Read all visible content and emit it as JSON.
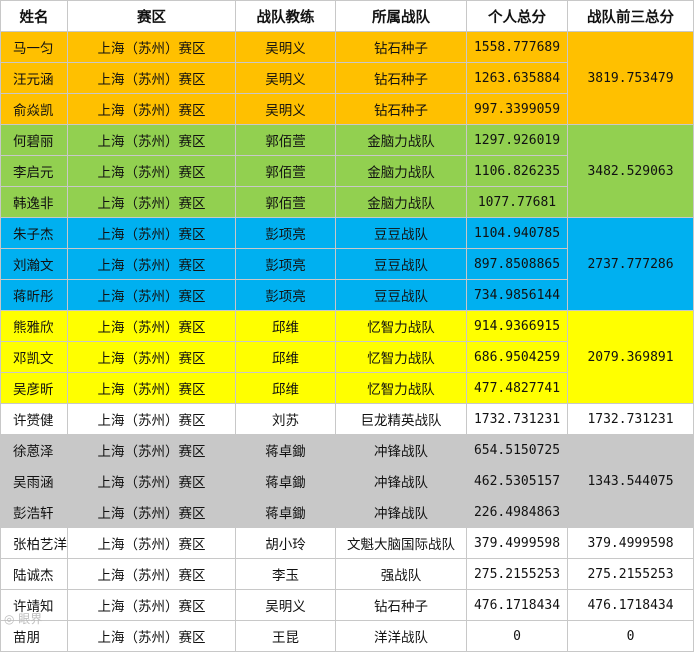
{
  "headers": [
    "姓名",
    "赛区",
    "战队教练",
    "所属战队",
    "个人总分",
    "战队前三总分"
  ],
  "groups": [
    {
      "color": "#ffc000",
      "total": "3819.753479",
      "rows": [
        [
          "马一匀",
          "上海（苏州）赛区",
          "吴明义",
          "钻石种子",
          "1558.777689"
        ],
        [
          "汪元涵",
          "上海（苏州）赛区",
          "吴明义",
          "钻石种子",
          "1263.635884"
        ],
        [
          "俞焱凯",
          "上海（苏州）赛区",
          "吴明义",
          "钻石种子",
          "997.3399059"
        ]
      ]
    },
    {
      "color": "#92d050",
      "total": "3482.529063",
      "rows": [
        [
          "何碧丽",
          "上海（苏州）赛区",
          "郭佰萱",
          "金脑力战队",
          "1297.926019"
        ],
        [
          "李启元",
          "上海（苏州）赛区",
          "郭佰萱",
          "金脑力战队",
          "1106.826235"
        ],
        [
          "韩逸非",
          "上海（苏州）赛区",
          "郭佰萱",
          "金脑力战队",
          "1077.77681"
        ]
      ]
    },
    {
      "color": "#00b0f0",
      "total": "2737.777286",
      "rows": [
        [
          "朱子杰",
          "上海（苏州）赛区",
          "彭项亮",
          "豆豆战队",
          "1104.940785"
        ],
        [
          "刘瀚文",
          "上海（苏州）赛区",
          "彭项亮",
          "豆豆战队",
          "897.8508865"
        ],
        [
          "蒋昕彤",
          "上海（苏州）赛区",
          "彭项亮",
          "豆豆战队",
          "734.9856144"
        ]
      ]
    },
    {
      "color": "#ffff00",
      "total": "2079.369891",
      "rows": [
        [
          "熊雅欣",
          "上海（苏州）赛区",
          "邱维",
          "忆智力战队",
          "914.9366915"
        ],
        [
          "邓凯文",
          "上海（苏州）赛区",
          "邱维",
          "忆智力战队",
          "686.9504259"
        ],
        [
          "吴彦昕",
          "上海（苏州）赛区",
          "邱维",
          "忆智力战队",
          "477.4827741"
        ]
      ]
    },
    {
      "color": "#ffffff",
      "total": "1732.731231",
      "rows": [
        [
          "许赟健",
          "上海（苏州）赛区",
          "刘苏",
          "巨龙精英战队",
          "1732.731231"
        ]
      ]
    },
    {
      "color": "#c8c8c8",
      "total": "1343.544075",
      "rows": [
        [
          "徐蒽泽",
          "上海（苏州）赛区",
          "蒋卓鋤",
          "冲锋战队",
          "654.5150725"
        ],
        [
          "吴雨涵",
          "上海（苏州）赛区",
          "蒋卓鋤",
          "冲锋战队",
          "462.5305157"
        ],
        [
          "彭浩轩",
          "上海（苏州）赛区",
          "蒋卓鋤",
          "冲锋战队",
          "226.4984863"
        ]
      ]
    },
    {
      "color": "#ffffff",
      "total": "379.4999598",
      "rows": [
        [
          "张柏艺洋",
          "上海（苏州）赛区",
          "胡小玲",
          "文魁大脑国际战队",
          "379.4999598"
        ]
      ]
    },
    {
      "color": "#ffffff",
      "total": "275.2155253",
      "rows": [
        [
          "陆诚杰",
          "上海（苏州）赛区",
          "李玉",
          "强战队",
          "275.2155253"
        ]
      ]
    },
    {
      "color": "#ffffff",
      "total": "476.1718434",
      "rows": [
        [
          "许靖知",
          "上海（苏州）赛区",
          "吴明义",
          "钻石种子",
          "476.1718434"
        ]
      ]
    },
    {
      "color": "#ffffff",
      "total": "0",
      "rows": [
        [
          "苗朋",
          "上海（苏州）赛区",
          "王昆",
          "洋洋战队",
          "0"
        ]
      ]
    }
  ]
}
